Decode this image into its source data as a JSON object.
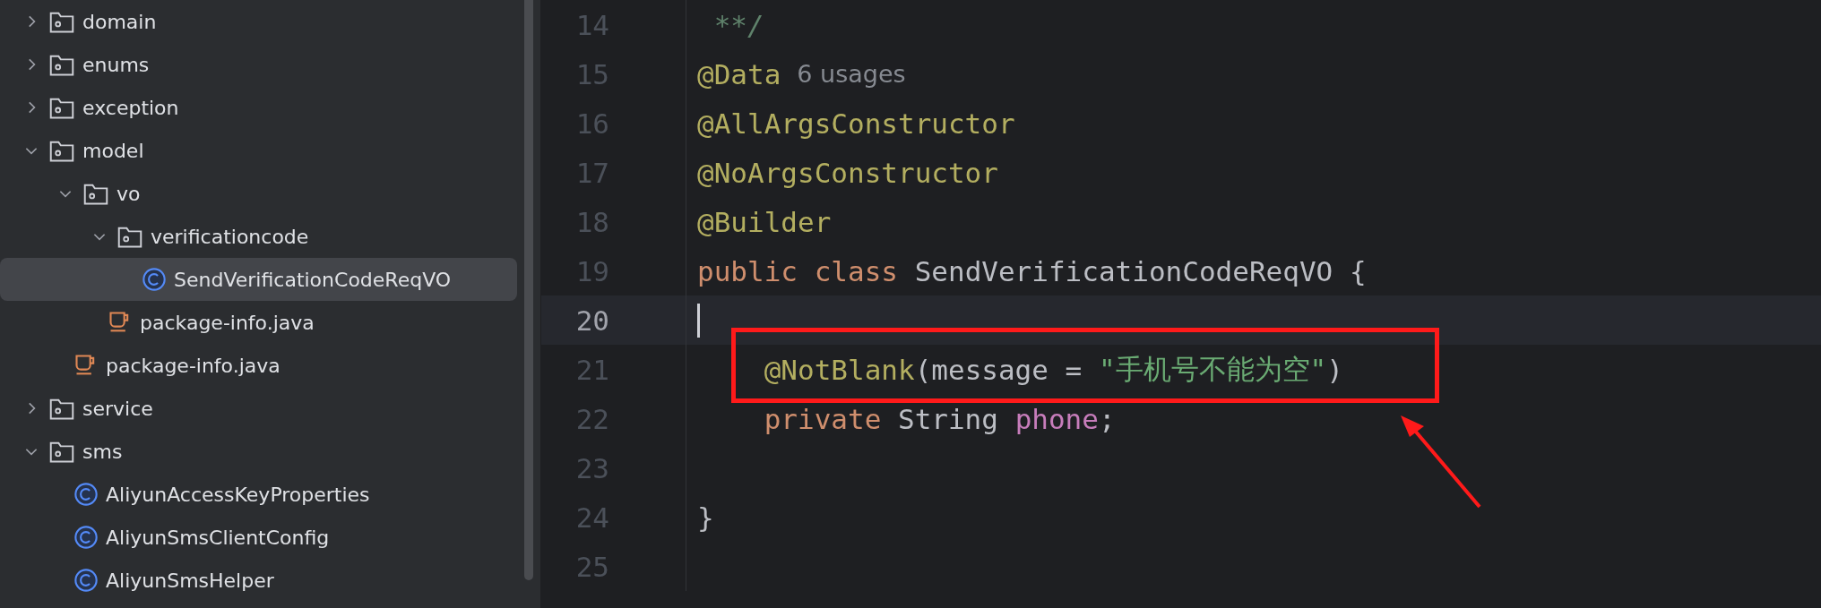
{
  "project_tree": [
    {
      "kind": "folder",
      "label": "domain",
      "expanded": false,
      "selected": false
    },
    {
      "kind": "folder",
      "label": "enums",
      "expanded": false,
      "selected": false
    },
    {
      "kind": "folder",
      "label": "exception",
      "expanded": false,
      "selected": false
    },
    {
      "kind": "folder",
      "label": "model",
      "expanded": true,
      "selected": false,
      "children": [
        {
          "kind": "folder",
          "label": "vo",
          "expanded": true,
          "selected": false,
          "children": [
            {
              "kind": "folder",
              "label": "verificationcode",
              "expanded": true,
              "selected": false,
              "children": [
                {
                  "kind": "class",
                  "label": "SendVerificationCodeReqVO",
                  "selected": true
                }
              ]
            },
            {
              "kind": "java",
              "label": "package-info.java",
              "selected": false
            }
          ]
        },
        {
          "kind": "java",
          "label": "package-info.java",
          "selected": false
        }
      ]
    },
    {
      "kind": "folder",
      "label": "service",
      "expanded": false,
      "selected": false
    },
    {
      "kind": "folder",
      "label": "sms",
      "expanded": true,
      "selected": false,
      "children": [
        {
          "kind": "class",
          "label": "AliyunAccessKeyProperties",
          "selected": false
        },
        {
          "kind": "class",
          "label": "AliyunSmsClientConfig",
          "selected": false
        },
        {
          "kind": "class",
          "label": "AliyunSmsHelper",
          "selected": false
        }
      ]
    }
  ],
  "editor": {
    "lines": [
      {
        "number": "14",
        "current": false,
        "tokens": [
          {
            "kind": "comment",
            "text": " **/"
          }
        ]
      },
      {
        "number": "15",
        "current": false,
        "tokens": [
          {
            "kind": "annotation",
            "text": "@Data"
          },
          {
            "kind": "hint",
            "text": "6 usages"
          }
        ]
      },
      {
        "number": "16",
        "current": false,
        "tokens": [
          {
            "kind": "annotation",
            "text": "@AllArgsConstructor"
          }
        ]
      },
      {
        "number": "17",
        "current": false,
        "tokens": [
          {
            "kind": "annotation",
            "text": "@NoArgsConstructor"
          }
        ]
      },
      {
        "number": "18",
        "current": false,
        "tokens": [
          {
            "kind": "annotation",
            "text": "@Builder"
          }
        ]
      },
      {
        "number": "19",
        "current": false,
        "tokens": [
          {
            "kind": "keyword",
            "text": "public class "
          },
          {
            "kind": "plain",
            "text": "SendVerificationCodeReqVO {"
          }
        ]
      },
      {
        "number": "20",
        "current": true
      },
      {
        "number": "21",
        "current": false,
        "tokens": [
          {
            "kind": "annotation",
            "text": "    @NotBlank"
          },
          {
            "kind": "plain",
            "text": "(message = "
          },
          {
            "kind": "string",
            "text": "\"手机号不能为空\""
          },
          {
            "kind": "plain",
            "text": ")"
          }
        ]
      },
      {
        "number": "22",
        "current": false,
        "tokens": [
          {
            "kind": "keyword",
            "text": "    private "
          },
          {
            "kind": "plain",
            "text": "String "
          },
          {
            "kind": "field",
            "text": "phone"
          },
          {
            "kind": "plain",
            "text": ";"
          }
        ]
      },
      {
        "number": "23",
        "current": false
      },
      {
        "number": "24",
        "current": false,
        "tokens": [
          {
            "kind": "plain",
            "text": "}"
          }
        ]
      },
      {
        "number": "25",
        "current": false
      }
    ]
  }
}
